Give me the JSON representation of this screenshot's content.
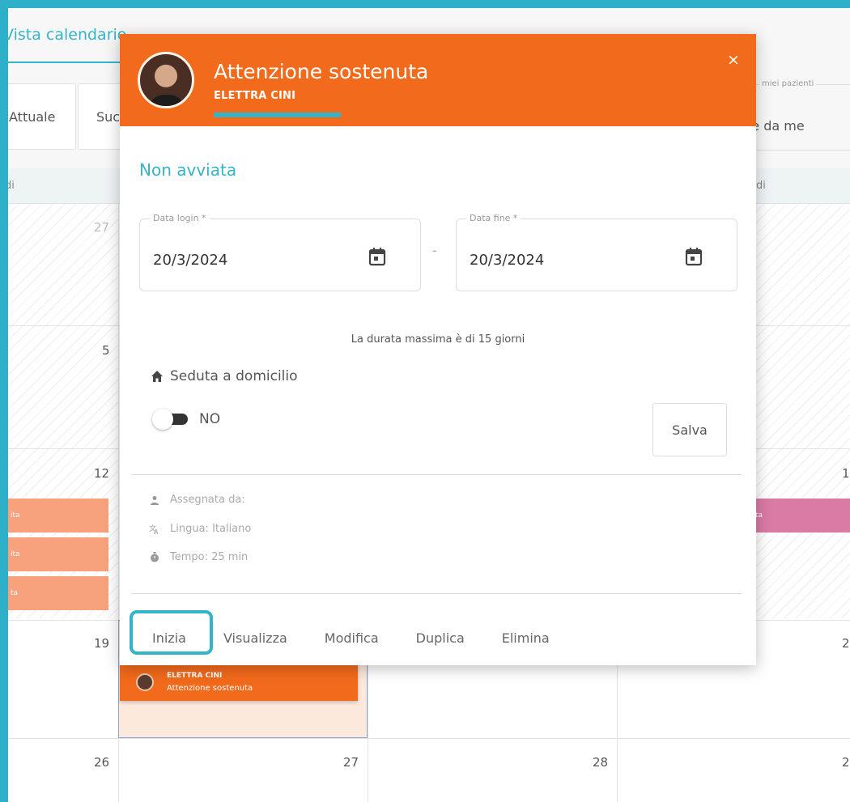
{
  "calendar": {
    "title": "Vista calendario",
    "buttons": {
      "current": "Attuale",
      "next": "Suc"
    },
    "right_field": {
      "label": "miei pazienti",
      "value": "te da me"
    },
    "header": {
      "left": "di",
      "right": "di"
    },
    "days": {
      "d27": "27",
      "d5": "5",
      "d12": "12",
      "d19": "19",
      "d26": "26",
      "d27b": "27",
      "d28": "28",
      "r1": "1",
      "r2": "2",
      "r3": "2"
    },
    "events": {
      "e1": "ita",
      "e2": "ita",
      "e3": "ta",
      "e4": "ta"
    },
    "big_event": {
      "name": "ELETTRA CINI",
      "title": "Attenzione sostenuta"
    }
  },
  "modal": {
    "title": "Attenzione sostenuta",
    "subtitle": "ELETTRA CINI",
    "close": "×",
    "status": "Non avviata",
    "start_date": {
      "label": "Data login *",
      "value": "20/3/2024"
    },
    "end_date": {
      "label": "Data fine *",
      "value": "20/3/2024"
    },
    "separator": "-",
    "hint": "La durata massima è di 15 giorni",
    "home_label": "Seduta a domicilio",
    "toggle_label": "NO",
    "save_label": "Salva",
    "info": {
      "assigned": "Assegnata da:",
      "language": "Lingua: Italiano",
      "time": "Tempo: 25 min"
    },
    "actions": {
      "start": "Inizia",
      "view": "Visualizza",
      "edit": "Modifica",
      "duplicate": "Duplica",
      "delete": "Elimina"
    }
  },
  "colors": {
    "accent": "#35b3c8",
    "header": "#f26a1b"
  }
}
